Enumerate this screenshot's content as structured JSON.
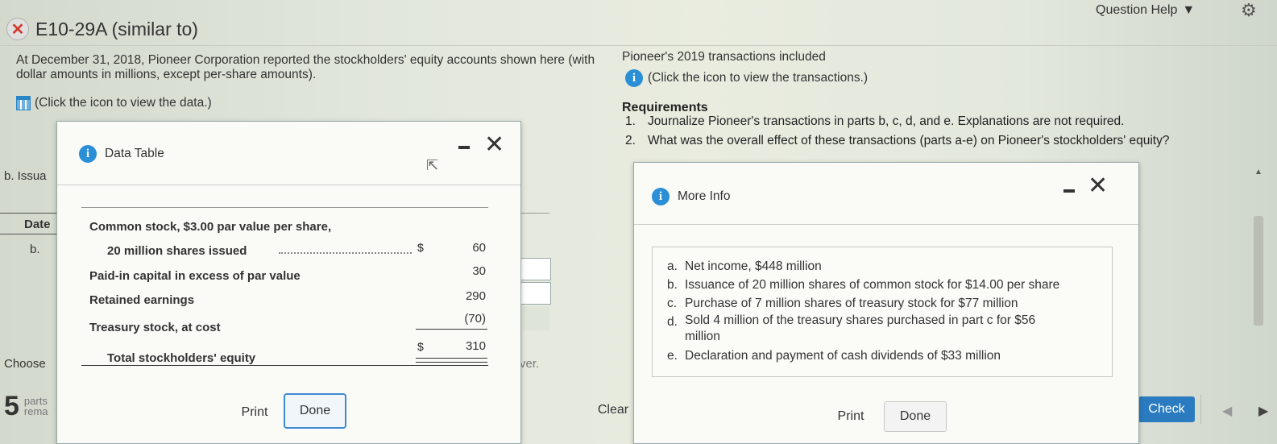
{
  "header": {
    "title": "E10-29A (similar to)",
    "question_help": "Question Help"
  },
  "left_intro": {
    "text": "At December 31, 2018, Pioneer Corporation reported the stockholders' equity accounts shown here (with dollar amounts in millions, except per-share amounts).",
    "data_link": "(Click the icon to view the data.)"
  },
  "right_intro": {
    "text": "Pioneer's 2019 transactions included",
    "transactions_link": "(Click the icon to view the transactions.)",
    "requirements_title": "Requirements",
    "requirements": [
      {
        "num": "1.",
        "text": "Journalize Pioneer's transactions in parts b, c, d, and e. Explanations are not required."
      },
      {
        "num": "2.",
        "text": "What was the overall effect of these transactions (parts a-e) on Pioneer's stockholders' equity?"
      }
    ]
  },
  "workspace": {
    "issue_label": "b. Issua",
    "date_header": "Date",
    "row_label": "b.",
    "choose_label": "Choose",
    "ver_fragment": "ver.",
    "parts_count": "5",
    "parts_label": "parts",
    "remaining_label": "rema",
    "clear_button": "Clear",
    "check_button": "Check"
  },
  "data_table": {
    "title": "Data Table",
    "rows": [
      {
        "label": "Common stock, $3.00 par value per share,",
        "currency": "",
        "value": ""
      },
      {
        "label": "20 million shares issued",
        "currency": "$",
        "value": "60"
      },
      {
        "label": "Paid-in capital in excess of par value",
        "currency": "",
        "value": "30"
      },
      {
        "label": "Retained earnings",
        "currency": "",
        "value": "290"
      },
      {
        "label": "Treasury stock, at cost",
        "currency": "",
        "value": "(70)"
      },
      {
        "label": "Total stockholders' equity",
        "currency": "$",
        "value": "310"
      }
    ],
    "print_button": "Print",
    "done_button": "Done"
  },
  "more_info": {
    "title": "More Info",
    "items": [
      {
        "letter": "a.",
        "text": "Net income, $448 million"
      },
      {
        "letter": "b.",
        "text": "Issuance of 20 million shares of common stock for $14.00 per share"
      },
      {
        "letter": "c.",
        "text": "Purchase of 7 million shares of treasury stock for $77 million"
      },
      {
        "letter": "d.",
        "text": "Sold 4 million of the treasury shares purchased in part c for $56 million"
      },
      {
        "letter": "e.",
        "text": "Declaration and payment of cash dividends of $33 million"
      }
    ],
    "print_button": "Print",
    "done_button": "Done"
  },
  "colors": {
    "accent": "#2a7bbf",
    "error_red": "#d23a2c",
    "info_blue": "#2a8fd6"
  }
}
